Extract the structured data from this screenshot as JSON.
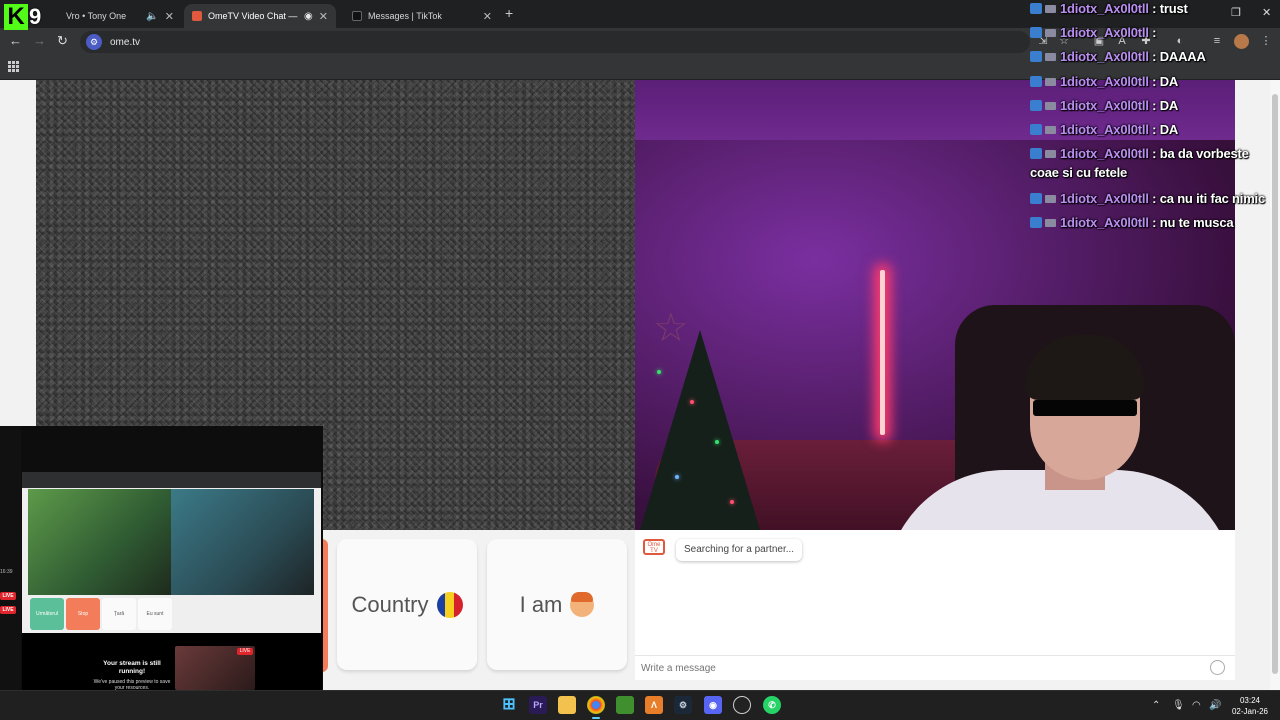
{
  "browser": {
    "tabs": [
      {
        "title": "Kick — Ovro • Tony One",
        "visible_title": "Vro • Tony One"
      },
      {
        "title": "OmeTV Video Chat — Ome",
        "active": true
      },
      {
        "title": "Messages | TikTok"
      }
    ],
    "new_tab_label": "+",
    "url": "ome.tv"
  },
  "overlay_logo": {
    "letter": "K",
    "number": "9"
  },
  "stream_chat": [
    {
      "user": "1diotx_Ax0l0tll",
      "sep": " : ",
      "text": "trust"
    },
    {
      "user": "1diotx_Ax0l0tll",
      "sep": " : ",
      "text": ""
    },
    {
      "user": "1diotx_Ax0l0tll",
      "sep": " : ",
      "text": "DAAAA"
    },
    {
      "user": "1diotx_Ax0l0tll",
      "sep": " : ",
      "text": "DA"
    },
    {
      "user": "1diotx_Ax0l0tll",
      "sep": " : ",
      "text": "DA"
    },
    {
      "user": "1diotx_Ax0l0tll",
      "sep": " : ",
      "text": "DA"
    },
    {
      "user": "1diotx_Ax0l0tll",
      "sep": " : ",
      "text": "ba da vorbeste coae si cu fetele"
    },
    {
      "user": "1diotx_Ax0l0tll",
      "sep": " : ",
      "text": "ca nu iti fac nimic"
    },
    {
      "user": "1diotx_Ax0l0tll",
      "sep": " : ",
      "text": "nu te musca"
    }
  ],
  "controls": {
    "country_label": "Country",
    "country_flag": "RO",
    "i_am_label": "I am"
  },
  "chat": {
    "status": "Searching for a partner...",
    "logo_text": "Ome TV",
    "input_placeholder": "Write a message"
  },
  "stream_preview": {
    "live_badge": "LIVE",
    "time": "16:39",
    "message_title": "Your stream is still running!",
    "message_sub": "We've paused this preview to save your resources.",
    "mini_buttons": [
      "Următorul",
      "Stop",
      "Țară",
      "Eu sunt"
    ]
  },
  "taskbar": {
    "time": "03:24",
    "date": "02-Jan-26",
    "apps": [
      "windows",
      "premiere",
      "file-explorer",
      "chrome",
      "minecraft",
      "app-a",
      "steam",
      "discord",
      "obs",
      "whatsapp"
    ]
  },
  "colors": {
    "accent_orange": "#f37d5a",
    "kick_green": "#53fc18",
    "chat_username": "#b98ef0"
  }
}
